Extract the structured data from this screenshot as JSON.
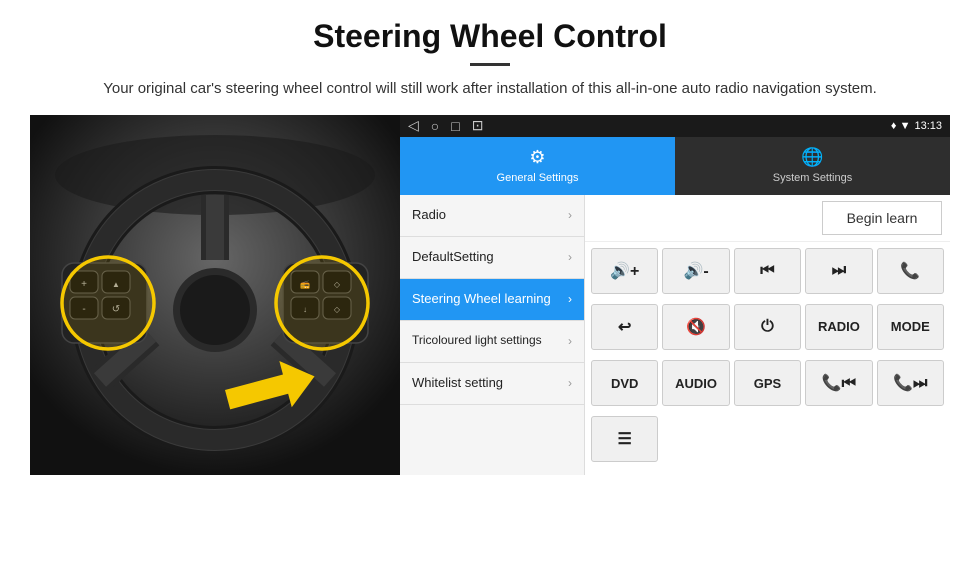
{
  "header": {
    "title": "Steering Wheel Control",
    "subtitle": "Your original car's steering wheel control will still work after installation of this all-in-one auto radio navigation system."
  },
  "status_bar": {
    "nav_icons": [
      "◁",
      "○",
      "□",
      "⊡"
    ],
    "right_icons": "♦ ▼",
    "time": "13:13"
  },
  "tabs": [
    {
      "id": "general",
      "label": "General Settings",
      "active": true
    },
    {
      "id": "system",
      "label": "System Settings",
      "active": false
    }
  ],
  "menu_items": [
    {
      "id": "radio",
      "label": "Radio",
      "active": false
    },
    {
      "id": "default",
      "label": "DefaultSetting",
      "active": false
    },
    {
      "id": "steering",
      "label": "Steering Wheel learning",
      "active": true
    },
    {
      "id": "tricoloured",
      "label": "Tricoloured light settings",
      "active": false
    },
    {
      "id": "whitelist",
      "label": "Whitelist setting",
      "active": false
    }
  ],
  "begin_learn_btn": "Begin learn",
  "control_buttons": [
    {
      "id": "vol_up",
      "label": "◄+",
      "row": 1
    },
    {
      "id": "vol_down",
      "label": "◄-",
      "row": 1
    },
    {
      "id": "prev_track",
      "label": "◄◄",
      "row": 1
    },
    {
      "id": "next_track",
      "label": "▶▶",
      "row": 1
    },
    {
      "id": "phone",
      "label": "📞",
      "row": 1
    },
    {
      "id": "hang_up",
      "label": "↩",
      "row": 2
    },
    {
      "id": "mute",
      "label": "◄✕",
      "row": 2
    },
    {
      "id": "power",
      "label": "⏻",
      "row": 2
    },
    {
      "id": "radio_btn",
      "label": "RADIO",
      "row": 2
    },
    {
      "id": "mode_btn",
      "label": "MODE",
      "row": 2
    },
    {
      "id": "dvd_btn",
      "label": "DVD",
      "row": 3
    },
    {
      "id": "audio_btn",
      "label": "AUDIO",
      "row": 3
    },
    {
      "id": "gps_btn",
      "label": "GPS",
      "row": 3
    },
    {
      "id": "tel_prev",
      "label": "📞◄◄",
      "row": 3
    },
    {
      "id": "tel_next",
      "label": "📞▶▶",
      "row": 3
    }
  ],
  "whitelist_icon": "☰",
  "colors": {
    "active_tab": "#2196F3",
    "inactive_tab": "#2e2e2e",
    "active_menu": "#2196F3",
    "status_bar_bg": "#1a1a1a",
    "device_bg": "#1a1a1a"
  }
}
